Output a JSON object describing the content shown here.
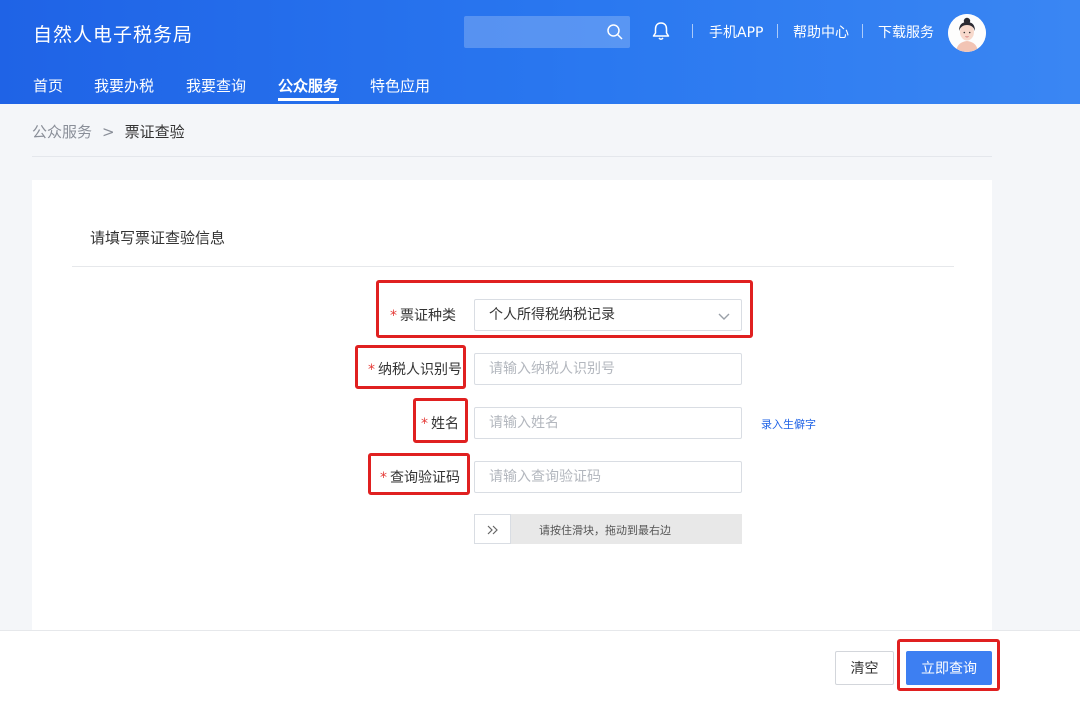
{
  "header": {
    "app_title": "自然人电子税务局",
    "search": {
      "value": "",
      "placeholder": ""
    },
    "links": [
      "手机APP",
      "帮助中心",
      "下载服务"
    ]
  },
  "nav": {
    "items": [
      {
        "label": "首页",
        "active": false
      },
      {
        "label": "我要办税",
        "active": false
      },
      {
        "label": "我要查询",
        "active": false
      },
      {
        "label": "公众服务",
        "active": true
      },
      {
        "label": "特色应用",
        "active": false
      }
    ]
  },
  "breadcrumb": {
    "parent": "公众服务",
    "separator": ">",
    "current": "票证查验"
  },
  "form": {
    "title": "请填写票证查验信息",
    "required_mark": "*",
    "ticket_type": {
      "label": "票证种类",
      "value": "个人所得税纳税记录",
      "icon": "chevron-down-icon"
    },
    "taxpayer_id": {
      "label": "纳税人识别号",
      "value": "",
      "placeholder": "请输入纳税人识别号"
    },
    "name": {
      "label": "姓名",
      "value": "",
      "placeholder": "请输入姓名",
      "rare_char_link": "录入生僻字"
    },
    "verify_code": {
      "label": "查询验证码",
      "value": "",
      "placeholder": "请输入查询验证码"
    },
    "slider": {
      "handle_icon": "double-chevron-right-icon",
      "text": "请按住滑块，拖动到最右边"
    }
  },
  "footer": {
    "clear_label": "清空",
    "query_label": "立即查询"
  },
  "colors": {
    "brand_blue": "#1f63e6",
    "button_blue": "#3d7ff2",
    "highlight_red": "#e02020",
    "required_red": "#e53935"
  }
}
